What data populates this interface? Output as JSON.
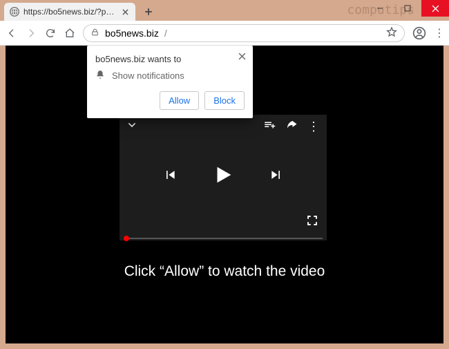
{
  "watermark": "computips",
  "tab": {
    "title": "https://bo5news.biz/?p=ge2wen"
  },
  "address": {
    "domain": "bo5news.biz",
    "path": "/"
  },
  "notification": {
    "origin_wants": "bo5news.biz wants to",
    "permission_label": "Show notifications",
    "allow": "Allow",
    "block": "Block"
  },
  "page": {
    "caption": "Click “Allow” to watch the video"
  }
}
